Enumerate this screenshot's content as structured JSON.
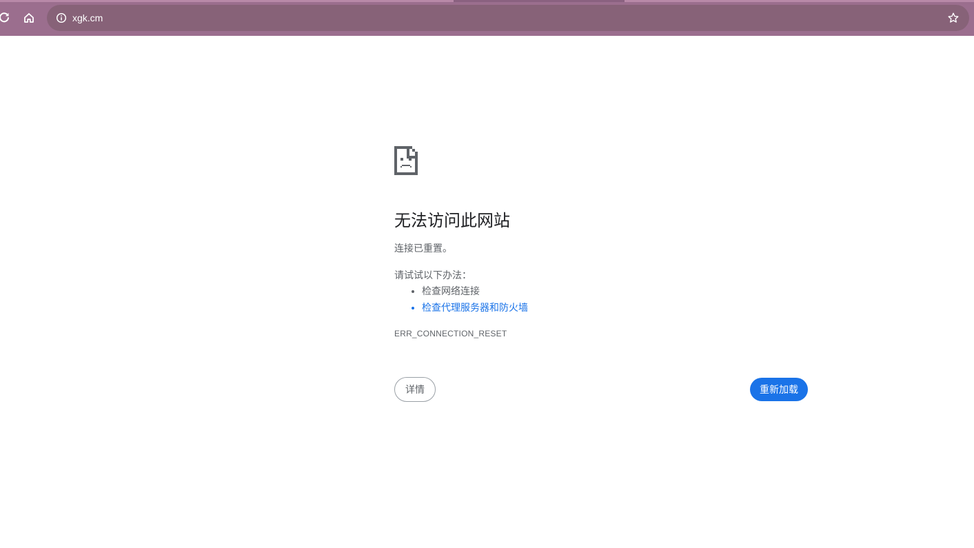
{
  "browser": {
    "url": "xgk.cm",
    "colors": {
      "toolbar": "#9b6e8e",
      "omnibox": "#876278"
    },
    "icons": {
      "reload": "reload-icon",
      "home": "home-icon",
      "site_info": "info-icon",
      "bookmark": "star-icon"
    }
  },
  "error_page": {
    "icon": "sad-page-icon",
    "title": "无法访问此网站",
    "subtitle": "连接已重置。",
    "suggestions_label": "请试试以下办法：",
    "suggestions": [
      "检查网络连接",
      "检查代理服务器和防火墙"
    ],
    "error_code": "ERR_CONNECTION_RESET",
    "details_button": "详情",
    "reload_button": "重新加载",
    "colors": {
      "link": "#1a73e8",
      "primary_button": "#1a73e8",
      "text": "#5f6368",
      "title": "#202124"
    }
  }
}
